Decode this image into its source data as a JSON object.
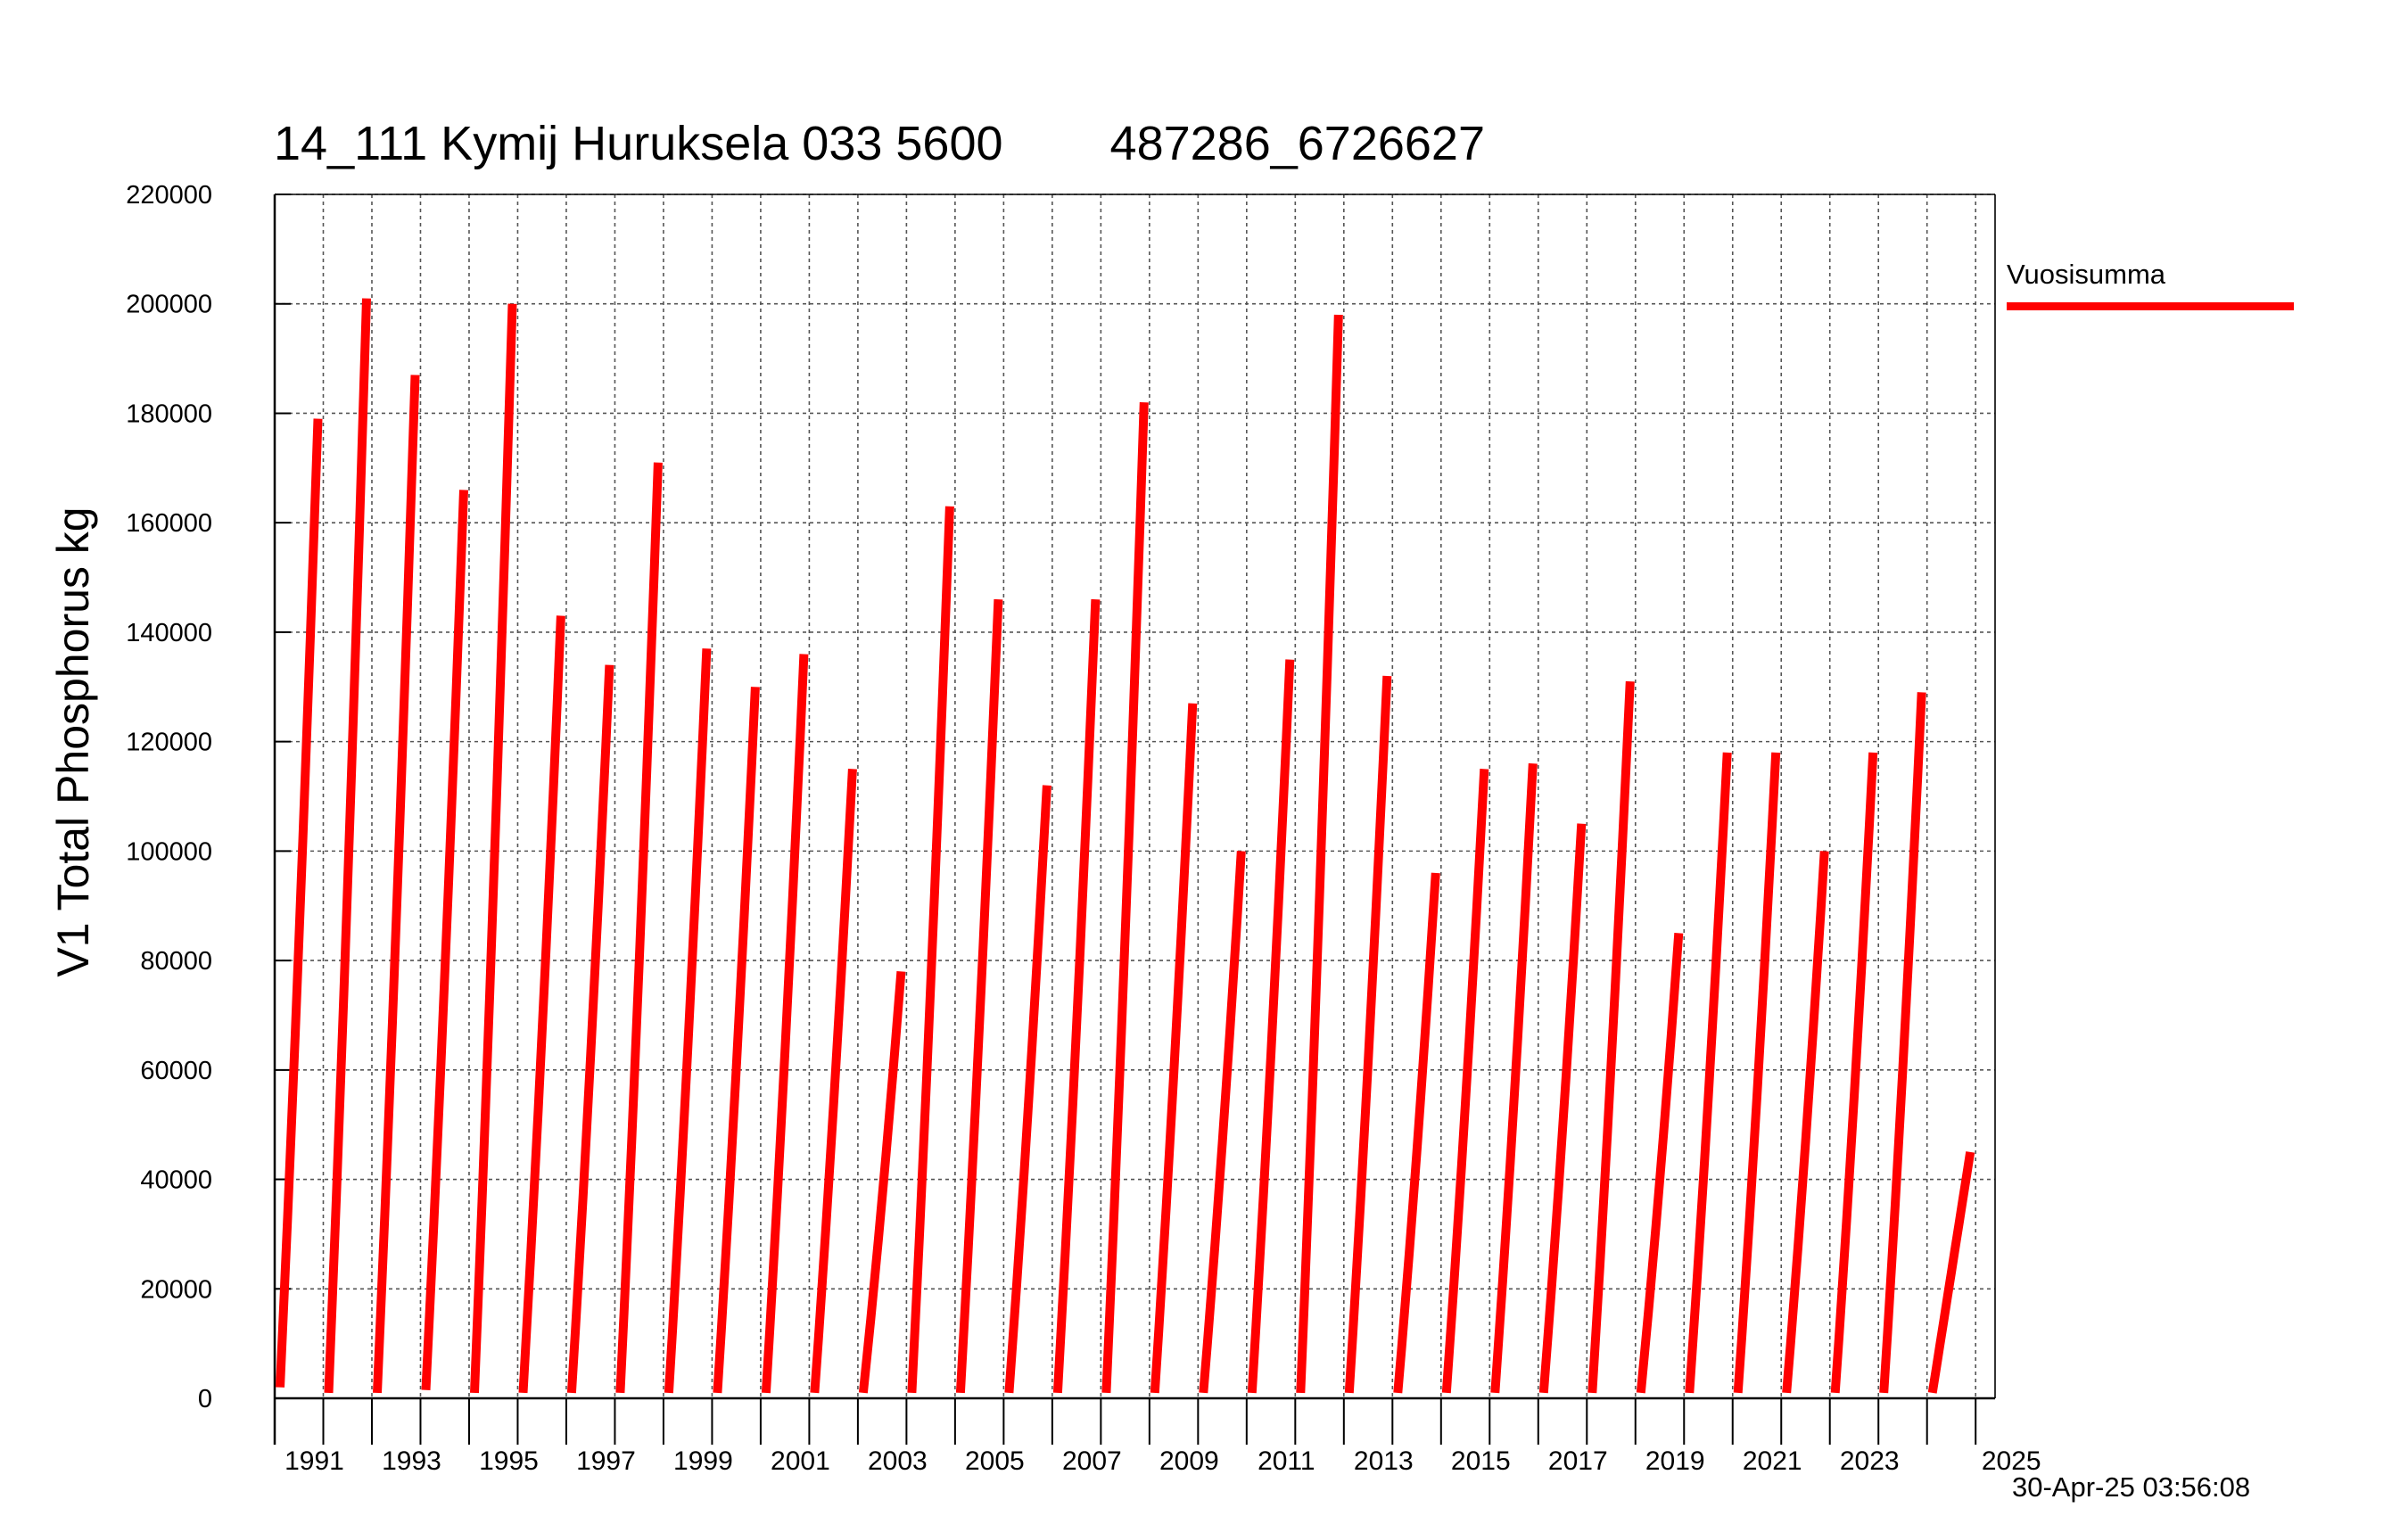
{
  "title": "14_111 Kymij Huruksela 033 5600        487286_6726627",
  "timestamp": "30-Apr-25 03:56:08",
  "colors": {
    "series": "#ff0000",
    "grid": "#555555",
    "axis": "#000000"
  },
  "chart_data": {
    "type": "line",
    "title": "14_111 Kymij Huruksela 033 5600        487286_6726627",
    "xlabel": "",
    "ylabel": "V1 Total Phosphorus kg",
    "xlim": [
      1990,
      2025.4
    ],
    "ylim": [
      0,
      220000
    ],
    "grid": true,
    "legend_position": "right",
    "y_ticks": [
      "0",
      "20000",
      "40000",
      "60000",
      "80000",
      "100000",
      "120000",
      "140000",
      "160000",
      "180000",
      "200000",
      "220000"
    ],
    "x_tick_labels": [
      "1991",
      "1993",
      "1995",
      "1997",
      "1999",
      "2001",
      "2003",
      "2005",
      "2007",
      "2009",
      "2011",
      "2013",
      "2015",
      "2017",
      "2019",
      "2021",
      "2023",
      "2025"
    ],
    "series": [
      {
        "name": "Vuosisumma",
        "description": "cumulative annual sum, resets each year",
        "years": [
          {
            "year": 1990,
            "values": [
              2000,
              179000
            ]
          },
          {
            "year": 1991,
            "values": [
              1000,
              201000
            ]
          },
          {
            "year": 1992,
            "values": [
              1000,
              187000
            ]
          },
          {
            "year": 1993,
            "values": [
              1500,
              166000
            ]
          },
          {
            "year": 1994,
            "values": [
              1000,
              200000
            ]
          },
          {
            "year": 1995,
            "values": [
              1000,
              143000
            ]
          },
          {
            "year": 1996,
            "values": [
              1000,
              134000
            ]
          },
          {
            "year": 1997,
            "values": [
              1000,
              171000
            ]
          },
          {
            "year": 1998,
            "values": [
              1000,
              137000
            ]
          },
          {
            "year": 1999,
            "values": [
              1000,
              130000
            ]
          },
          {
            "year": 2000,
            "values": [
              1000,
              136000
            ]
          },
          {
            "year": 2001,
            "values": [
              1000,
              115000
            ]
          },
          {
            "year": 2002,
            "values": [
              1000,
              78000
            ]
          },
          {
            "year": 2003,
            "values": [
              1000,
              163000
            ]
          },
          {
            "year": 2004,
            "values": [
              1000,
              146000
            ]
          },
          {
            "year": 2005,
            "values": [
              1000,
              112000
            ]
          },
          {
            "year": 2006,
            "values": [
              1000,
              146000
            ]
          },
          {
            "year": 2007,
            "values": [
              1000,
              182000
            ]
          },
          {
            "year": 2008,
            "values": [
              1000,
              127000
            ]
          },
          {
            "year": 2009,
            "values": [
              1000,
              100000
            ]
          },
          {
            "year": 2010,
            "values": [
              1000,
              135000
            ]
          },
          {
            "year": 2011,
            "values": [
              1000,
              198000
            ]
          },
          {
            "year": 2012,
            "values": [
              1000,
              132000
            ]
          },
          {
            "year": 2013,
            "values": [
              1000,
              96000
            ]
          },
          {
            "year": 2014,
            "values": [
              1000,
              115000
            ]
          },
          {
            "year": 2015,
            "values": [
              1000,
              116000
            ]
          },
          {
            "year": 2016,
            "values": [
              1000,
              105000
            ]
          },
          {
            "year": 2017,
            "values": [
              1000,
              131000
            ]
          },
          {
            "year": 2018,
            "values": [
              1000,
              85000
            ]
          },
          {
            "year": 2019,
            "values": [
              1000,
              118000
            ]
          },
          {
            "year": 2020,
            "values": [
              1000,
              118000
            ]
          },
          {
            "year": 2021,
            "values": [
              1000,
              100000
            ]
          },
          {
            "year": 2022,
            "values": [
              1000,
              118000
            ]
          },
          {
            "year": 2023,
            "values": [
              1000,
              129000
            ]
          },
          {
            "year": 2024,
            "values": [
              1000,
              45000
            ]
          }
        ]
      }
    ]
  }
}
